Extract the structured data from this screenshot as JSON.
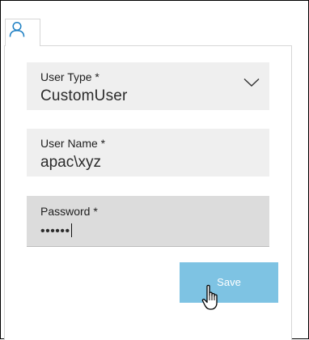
{
  "tabs": [
    {
      "icon": "user-icon",
      "active": true
    }
  ],
  "form": {
    "user_type": {
      "label": "User Type *",
      "value": "CustomUser",
      "icon": "chevron-down-icon"
    },
    "user_name": {
      "label": "User Name *",
      "value": "apac\\xyz"
    },
    "password": {
      "label": "Password *",
      "masked_value": "••••••"
    },
    "save_label": "Save"
  },
  "colors": {
    "field_bg": "#efefef",
    "field_focused_bg": "#dcdcdc",
    "button_bg": "#7ec3e3",
    "icon_blue": "#1d7fc3"
  }
}
